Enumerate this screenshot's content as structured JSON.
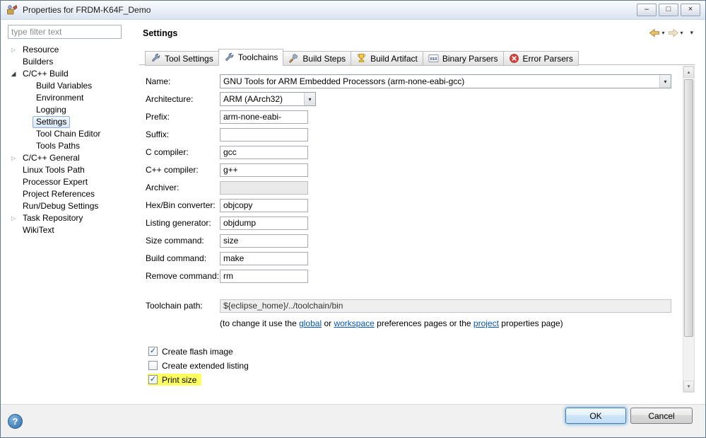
{
  "window": {
    "title": "Properties for FRDM-K64F_Demo"
  },
  "icons": {
    "minimize": "–",
    "restore": "□",
    "close": "×",
    "tree_collapsed": "▷",
    "tree_expanded": "◢",
    "caret_down": "▾",
    "scroll_up": "▴",
    "scroll_down": "▾",
    "check": "✓",
    "help": "?"
  },
  "sidebar": {
    "filter_placeholder": "type filter text",
    "tree": [
      {
        "label": "Resource",
        "level": 0,
        "expandable": true,
        "expanded": false
      },
      {
        "label": "Builders",
        "level": 0
      },
      {
        "label": "C/C++ Build",
        "level": 0,
        "expandable": true,
        "expanded": true
      },
      {
        "label": "Build Variables",
        "level": 1
      },
      {
        "label": "Environment",
        "level": 1
      },
      {
        "label": "Logging",
        "level": 1
      },
      {
        "label": "Settings",
        "level": 1,
        "selected": true
      },
      {
        "label": "Tool Chain Editor",
        "level": 1
      },
      {
        "label": "Tools Paths",
        "level": 1
      },
      {
        "label": "C/C++ General",
        "level": 0,
        "expandable": true,
        "expanded": false
      },
      {
        "label": "Linux Tools Path",
        "level": 0
      },
      {
        "label": "Processor Expert",
        "level": 0
      },
      {
        "label": "Project References",
        "level": 0
      },
      {
        "label": "Run/Debug Settings",
        "level": 0
      },
      {
        "label": "Task Repository",
        "level": 0,
        "expandable": true,
        "expanded": false
      },
      {
        "label": "WikiText",
        "level": 0
      }
    ]
  },
  "header": {
    "title": "Settings"
  },
  "tabs": [
    {
      "label": "Tool Settings",
      "icon": "wrench"
    },
    {
      "label": "Toolchains",
      "icon": "wrench",
      "active": true
    },
    {
      "label": "Build Steps",
      "icon": "hammer"
    },
    {
      "label": "Build Artifact",
      "icon": "trophy"
    },
    {
      "label": "Binary Parsers",
      "icon": "binary"
    },
    {
      "label": "Error Parsers",
      "icon": "error"
    }
  ],
  "form": {
    "fields": [
      {
        "label": "Name:",
        "type": "select",
        "wide": true,
        "value": "GNU Tools for ARM Embedded Processors (arm-none-eabi-gcc)"
      },
      {
        "label": "Architecture:",
        "type": "select",
        "value": "ARM (AArch32)"
      },
      {
        "label": "Prefix:",
        "type": "text",
        "value": "arm-none-eabi-"
      },
      {
        "label": "Suffix:",
        "type": "text",
        "value": ""
      },
      {
        "label": "C compiler:",
        "type": "text",
        "value": "gcc"
      },
      {
        "label": "C++ compiler:",
        "type": "text",
        "value": "g++"
      },
      {
        "label": "Archiver:",
        "type": "text",
        "value": "",
        "disabled": true
      },
      {
        "label": "Hex/Bin converter:",
        "type": "text",
        "value": "objcopy"
      },
      {
        "label": "Listing generator:",
        "type": "text",
        "value": "objdump"
      },
      {
        "label": "Size command:",
        "type": "text",
        "value": "size"
      },
      {
        "label": "Build command:",
        "type": "text",
        "value": "make"
      },
      {
        "label": "Remove command:",
        "type": "text",
        "value": "rm"
      }
    ],
    "toolchain_path": {
      "label": "Toolchain path:",
      "value": "${eclipse_home}/../toolchain/bin"
    },
    "note": [
      {
        "text": "(to change it use the "
      },
      {
        "text": "global",
        "link": true
      },
      {
        "text": " or "
      },
      {
        "text": "workspace",
        "link": true
      },
      {
        "text": " preferences pages or the "
      },
      {
        "text": "project",
        "link": true
      },
      {
        "text": " properties page)"
      }
    ],
    "checkboxes": [
      {
        "label": "Create flash image",
        "checked": true
      },
      {
        "label": "Create extended listing",
        "checked": false
      },
      {
        "label": "Print size",
        "checked": true,
        "highlighted": true
      }
    ]
  },
  "footer": {
    "ok": "OK",
    "cancel": "Cancel"
  }
}
